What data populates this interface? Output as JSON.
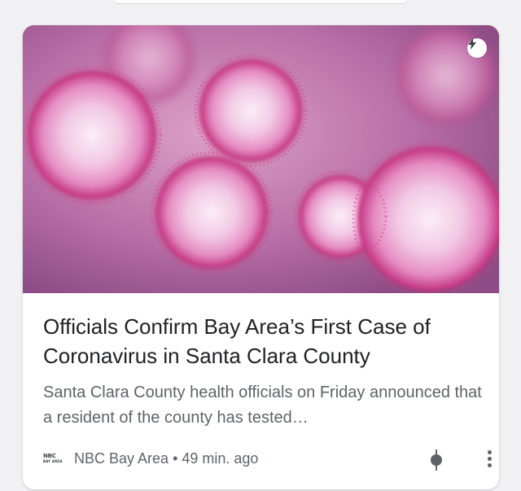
{
  "article": {
    "image_description_icon": "amp-lightning-icon",
    "headline": "Officials Confirm Bay Area’s First Case of Coronavirus in Santa Clara County",
    "snippet": "Santa Clara County health officials on Friday announced that a resident of the county has tested…",
    "source_logo_line1": "NBC",
    "source_logo_line2": "BAY AREA",
    "source": "NBC Bay Area",
    "separator": "•",
    "time": "49 min. ago"
  },
  "actions": {
    "focus_icon": "focus-dot-icon",
    "more_icon": "more-vert-icon"
  },
  "colors": {
    "headline": "#202124",
    "secondary_text": "#5f6368",
    "virus_pink": "#e05fa6",
    "virus_core": "#f7dff0"
  }
}
